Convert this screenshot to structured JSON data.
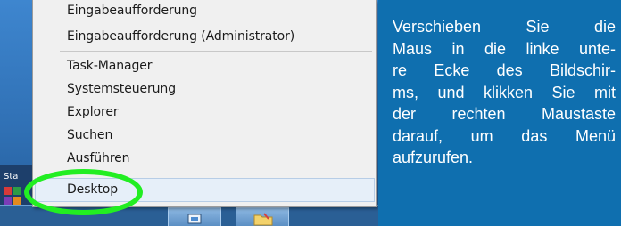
{
  "context_menu": {
    "items": [
      {
        "label": "Eingabeaufforderung"
      },
      {
        "label": "Eingabeaufforderung (Administrator)"
      },
      {
        "label": "Task-Manager"
      },
      {
        "label": "Systemsteuerung"
      },
      {
        "label": "Explorer"
      },
      {
        "label": "Suchen"
      },
      {
        "label": "Ausführen"
      },
      {
        "label": "Desktop",
        "highlighted": true
      }
    ]
  },
  "start_screen": {
    "label": "Sta"
  },
  "caption": {
    "lines": [
      "Verschieben Sie die",
      "Maus in die linke unte-",
      "re Ecke des Bildschir-",
      "ms, und klikken Sie mit",
      "der rechten Maustaste",
      "darauf, um das Menü",
      "aufzurufen."
    ]
  },
  "colors": {
    "caption_background": "#0f6faf",
    "highlight_ring": "#22ee22",
    "menu_background": "#f0f0f0"
  }
}
